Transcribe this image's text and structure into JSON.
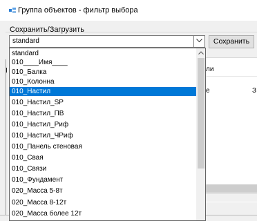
{
  "window": {
    "title": "Группа объектов - фильтр выбора"
  },
  "groupbox": {
    "label": "Сохранить/Загрузить"
  },
  "combo": {
    "value": "standard",
    "expanded": true
  },
  "buttons": {
    "save": "Сохранить"
  },
  "background": {
    "left_letter": "I",
    "header_fragment": "ли",
    "cell_a": "e",
    "cell_b": "З"
  },
  "dropdown": {
    "selected_index": 4,
    "items": [
      "standard",
      "010____Имя____",
      "010_Балка",
      "010_Колонна",
      "010_Настил",
      "010_Настил_SP",
      "010_Настил_ПВ",
      "010_Настил_Риф",
      "010_Настил_ЧРиф",
      "010_Панель стеновая",
      "010_Свая",
      "010_Связи",
      "010_Фундамент",
      "020_Масса 5-8т",
      "020_Масса 8-12т",
      "020_Масса более 12т"
    ]
  },
  "icons": {
    "app": "filter-app-icon",
    "dropdown": "chevron-down-icon",
    "scroll_up": "chevron-up-icon"
  },
  "colors": {
    "selection": "#0078d7",
    "window_bg": "#f0f0f0",
    "titlebar_bg": "#ffffff"
  }
}
